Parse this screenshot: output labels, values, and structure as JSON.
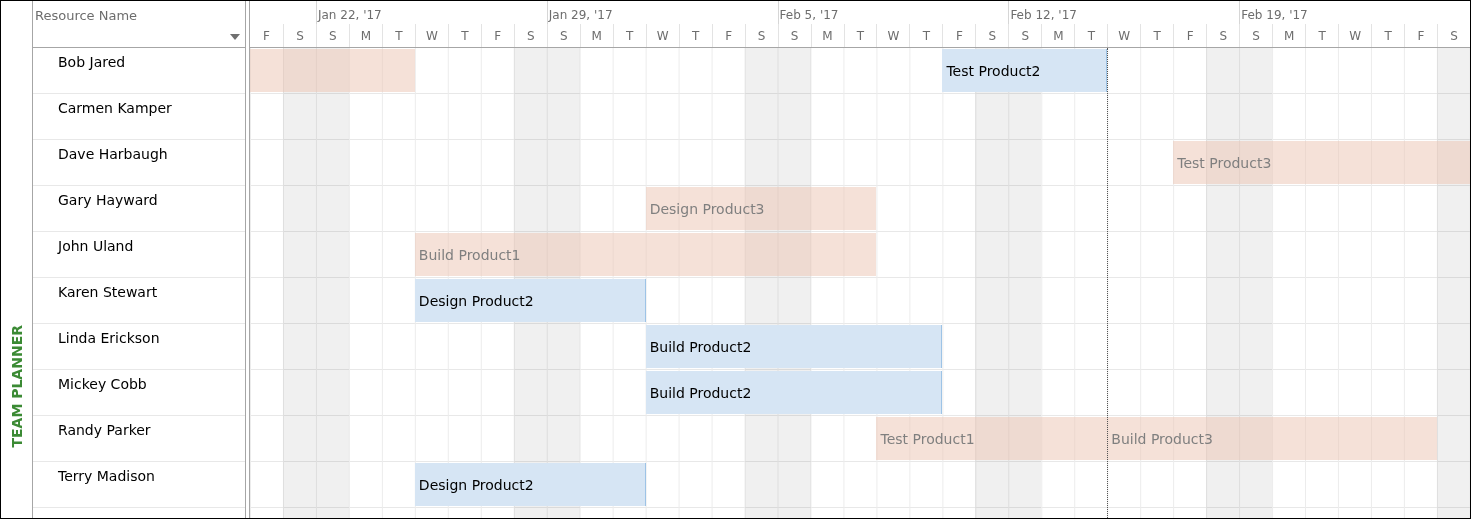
{
  "side_label": "TEAM PLANNER",
  "resource_column": {
    "header": "Resource Name"
  },
  "timescale": {
    "days": [
      {
        "letter": "F",
        "weekend": false
      },
      {
        "letter": "S",
        "weekend": true
      },
      {
        "letter": "S",
        "weekend": true,
        "week": "Jan 22, '17"
      },
      {
        "letter": "M",
        "weekend": false
      },
      {
        "letter": "T",
        "weekend": false
      },
      {
        "letter": "W",
        "weekend": false
      },
      {
        "letter": "T",
        "weekend": false
      },
      {
        "letter": "F",
        "weekend": false
      },
      {
        "letter": "S",
        "weekend": true
      },
      {
        "letter": "S",
        "weekend": true,
        "week": "Jan 29, '17"
      },
      {
        "letter": "M",
        "weekend": false
      },
      {
        "letter": "T",
        "weekend": false
      },
      {
        "letter": "W",
        "weekend": false
      },
      {
        "letter": "T",
        "weekend": false
      },
      {
        "letter": "F",
        "weekend": false
      },
      {
        "letter": "S",
        "weekend": true
      },
      {
        "letter": "S",
        "weekend": true,
        "week": "Feb 5, '17"
      },
      {
        "letter": "M",
        "weekend": false
      },
      {
        "letter": "T",
        "weekend": false
      },
      {
        "letter": "W",
        "weekend": false
      },
      {
        "letter": "T",
        "weekend": false
      },
      {
        "letter": "F",
        "weekend": false
      },
      {
        "letter": "S",
        "weekend": true
      },
      {
        "letter": "S",
        "weekend": true,
        "week": "Feb 12, '17"
      },
      {
        "letter": "M",
        "weekend": false
      },
      {
        "letter": "T",
        "weekend": false
      },
      {
        "letter": "W",
        "weekend": false
      },
      {
        "letter": "T",
        "weekend": false
      },
      {
        "letter": "F",
        "weekend": false
      },
      {
        "letter": "S",
        "weekend": true
      },
      {
        "letter": "S",
        "weekend": true,
        "week": "Feb 19, '17"
      },
      {
        "letter": "M",
        "weekend": false
      },
      {
        "letter": "T",
        "weekend": false
      },
      {
        "letter": "W",
        "weekend": false
      },
      {
        "letter": "T",
        "weekend": false
      },
      {
        "letter": "F",
        "weekend": false
      },
      {
        "letter": "S",
        "weekend": true
      }
    ]
  },
  "resources": [
    {
      "name": "Bob Jared",
      "bars": [
        {
          "kind": "muted"
        },
        {
          "kind": "normal",
          "label": "Test Product2"
        }
      ]
    },
    {
      "name": "Carmen Kamper"
    },
    {
      "name": "Dave Harbaugh",
      "bars": [
        {
          "kind": "muted",
          "label": "Test Product3"
        }
      ]
    },
    {
      "name": "Gary Hayward",
      "bars": [
        {
          "kind": "muted",
          "label": "Design Product3"
        }
      ]
    },
    {
      "name": "John Uland",
      "bars": [
        {
          "kind": "muted",
          "label": "Build Product1"
        }
      ]
    },
    {
      "name": "Karen Stewart",
      "bars": [
        {
          "kind": "normal",
          "label": "Design Product2"
        }
      ]
    },
    {
      "name": "Linda Erickson",
      "bars": [
        {
          "kind": "normal",
          "label": "Build Product2"
        }
      ]
    },
    {
      "name": "Mickey Cobb",
      "bars": [
        {
          "kind": "normal",
          "label": "Build Product2"
        }
      ]
    },
    {
      "name": "Randy Parker",
      "bars": [
        {
          "kind": "muted",
          "label": "Test Product1"
        },
        {
          "kind": "muted",
          "label": "Build Product3"
        }
      ]
    },
    {
      "name": "Terry Madison",
      "bars": [
        {
          "kind": "normal",
          "label": "Design Product2"
        }
      ]
    }
  ]
}
